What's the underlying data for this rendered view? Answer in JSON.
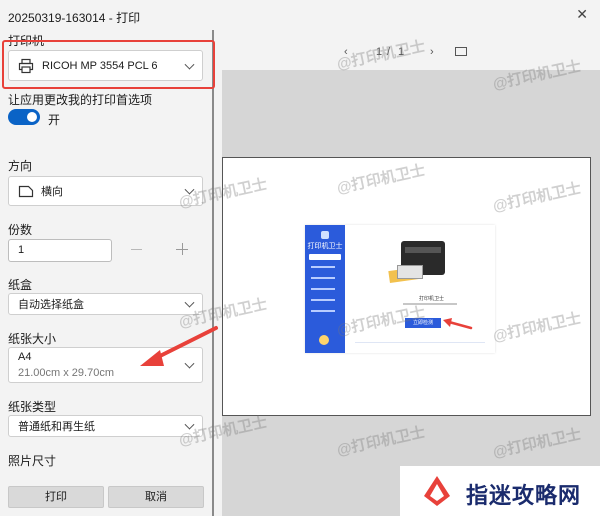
{
  "window": {
    "title": "20250319-163014 - 打印"
  },
  "printer": {
    "section_label": "打印机",
    "selected": "RICOH MP 3554 PCL 6"
  },
  "preferences": {
    "label": "让应用更改我的打印首选项",
    "toggle_state": "开"
  },
  "orientation": {
    "label": "方向",
    "selected": "横向"
  },
  "copies": {
    "label": "份数",
    "value": "1"
  },
  "tray": {
    "label": "纸盒",
    "selected": "自动选择纸盒"
  },
  "paper_size": {
    "label": "纸张大小",
    "selected": "A4",
    "dimensions": "21.00cm x 29.70cm"
  },
  "paper_type": {
    "label": "纸张类型",
    "selected": "普通纸和再生纸"
  },
  "photo_size": {
    "label": "照片尺寸"
  },
  "buttons": {
    "print": "打印",
    "cancel": "取消"
  },
  "preview": {
    "page_current": "1",
    "page_sep": "/",
    "page_total": "1",
    "app_card": {
      "app_title": "打印机卫士",
      "menu_items": [
        "",
        "",
        "",
        "",
        "",
        ""
      ],
      "center_title": "打印机卫士",
      "cta": "立即检测"
    }
  },
  "watermark": "@打印机卫士",
  "logo": {
    "text": "指迷攻略网"
  },
  "colors": {
    "accent": "#0a63c6",
    "highlight": "#e8413a",
    "arrow": "#e8413a"
  }
}
